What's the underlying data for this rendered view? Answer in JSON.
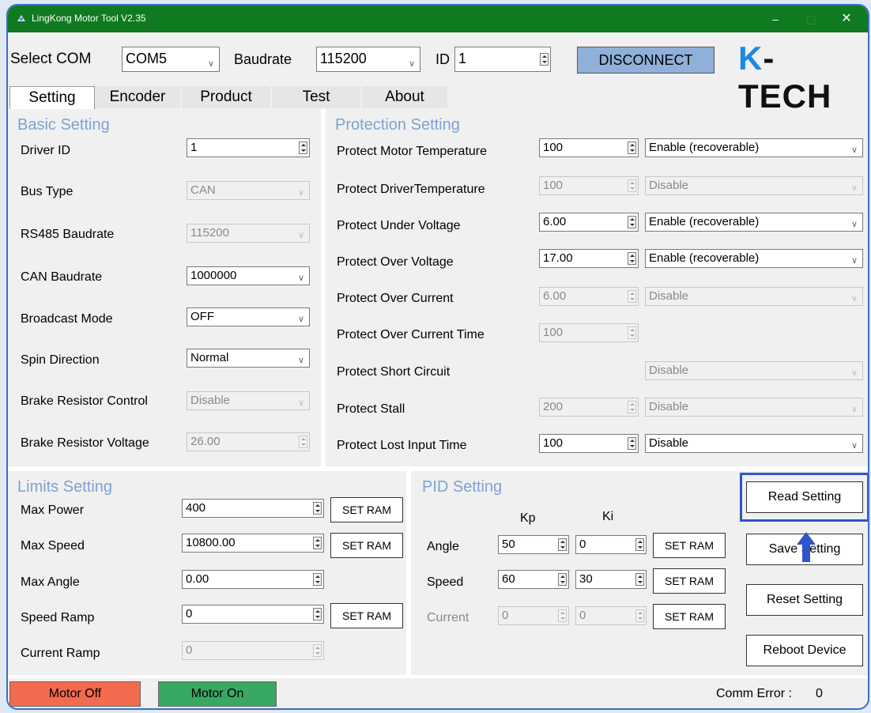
{
  "window": {
    "title": "LingKong Motor Tool V2.35"
  },
  "connection": {
    "com_label": "Select COM",
    "com_value": "COM5",
    "baud_label": "Baudrate",
    "baud_value": "115200",
    "id_label": "ID",
    "id_value": "1",
    "disconnect_label": "DISCONNECT"
  },
  "logo": {
    "text": "K-TECH"
  },
  "tabs": [
    "Setting",
    "Encoder",
    "Product",
    "Test",
    "About"
  ],
  "basic": {
    "title": "Basic Setting",
    "rows": [
      {
        "label": "Driver ID",
        "value": "1"
      },
      {
        "label": "Bus Type",
        "value": "CAN"
      },
      {
        "label": "RS485 Baudrate",
        "value": "115200"
      },
      {
        "label": "CAN Baudrate",
        "value": "1000000"
      },
      {
        "label": "Broadcast Mode",
        "value": "OFF"
      },
      {
        "label": "Spin Direction",
        "value": "Normal"
      },
      {
        "label": "Brake Resistor Control",
        "value": "Disable"
      },
      {
        "label": "Brake Resistor Voltage",
        "value": "26.00"
      }
    ]
  },
  "protection": {
    "title": "Protection Setting",
    "rows": [
      {
        "label": "Protect Motor Temperature",
        "value": "100",
        "mode": "Enable (recoverable)"
      },
      {
        "label": "Protect DriverTemperature",
        "value": "100",
        "mode": "Disable"
      },
      {
        "label": "Protect Under Voltage",
        "value": "6.00",
        "mode": "Enable (recoverable)"
      },
      {
        "label": "Protect Over Voltage",
        "value": "17.00",
        "mode": "Enable (recoverable)"
      },
      {
        "label": "Protect Over Current",
        "value": "6.00",
        "mode": "Disable"
      },
      {
        "label": "Protect Over Current Time",
        "value": "100"
      },
      {
        "label": "Protect Short Circuit",
        "mode": "Disable"
      },
      {
        "label": "Protect Stall",
        "value": "200",
        "mode": "Disable"
      },
      {
        "label": "Protect Lost Input Time",
        "value": "100",
        "mode": "Disable"
      }
    ]
  },
  "limits": {
    "title": "Limits Setting",
    "rows": [
      {
        "label": "Max Power",
        "value": "400"
      },
      {
        "label": "Max Speed",
        "value": "10800.00"
      },
      {
        "label": "Max Angle",
        "value": "0.00"
      },
      {
        "label": "Speed Ramp",
        "value": "0"
      },
      {
        "label": "Current Ramp",
        "value": "0"
      }
    ],
    "set_ram": "SET RAM"
  },
  "pid": {
    "title": "PID Setting",
    "kp_label": "Kp",
    "ki_label": "Ki",
    "rows": [
      {
        "label": "Angle",
        "kp": "50",
        "ki": "0"
      },
      {
        "label": "Speed",
        "kp": "60",
        "ki": "30"
      },
      {
        "label": "Current",
        "kp": "0",
        "ki": "0"
      }
    ],
    "set_ram": "SET RAM"
  },
  "actions": {
    "read": "Read Setting",
    "save": "Save Setting",
    "reset": "Reset Setting",
    "reboot": "Reboot Device"
  },
  "status": {
    "motor_off": "Motor Off",
    "motor_on": "Motor On",
    "comm_error_label": "Comm Error :",
    "comm_error_value": "0"
  },
  "colors": {
    "titlebar": "#0f7a1f",
    "group_title": "#7ea2d4",
    "highlight": "#2f55c8",
    "motor_off": "#f26b4f",
    "motor_on": "#3aa865",
    "disconnect_bg": "#8fb0d8"
  }
}
